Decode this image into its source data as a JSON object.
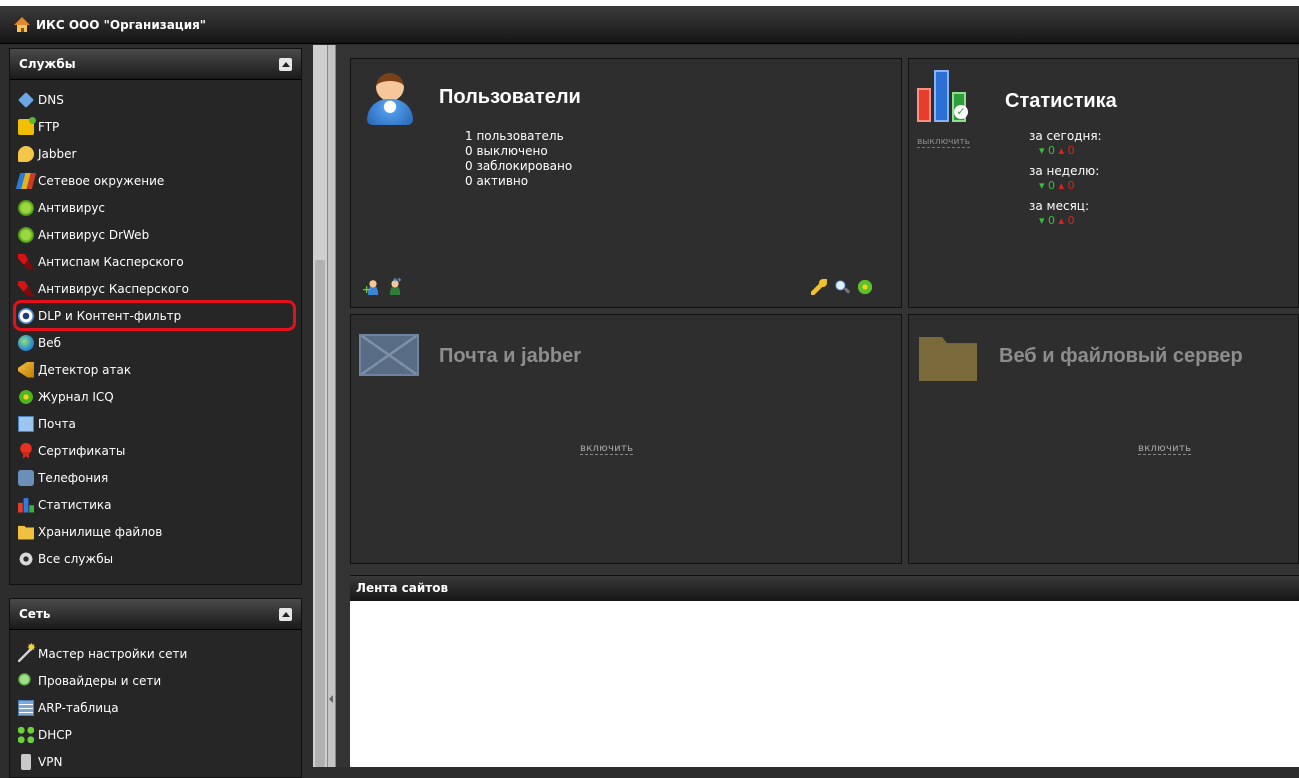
{
  "titlebar": {
    "title": "ИКС ООО \"Организация\""
  },
  "sidebar": {
    "services": {
      "title": "Службы",
      "items": [
        {
          "label": "DNS",
          "icon": "tag-icon"
        },
        {
          "label": "FTP",
          "icon": "ftp-icon"
        },
        {
          "label": "Jabber",
          "icon": "jabber-icon"
        },
        {
          "label": "Сетевое окружение",
          "icon": "network-icon"
        },
        {
          "label": "Антивирус",
          "icon": "bug-icon"
        },
        {
          "label": "Антивирус DrWeb",
          "icon": "bug-icon"
        },
        {
          "label": "Антиспам Касперского",
          "icon": "kaspersky-icon"
        },
        {
          "label": "Антивирус Касперского",
          "icon": "kaspersky-icon"
        },
        {
          "label": "DLP и Контент-фильтр",
          "icon": "eye-icon",
          "highlighted": true
        },
        {
          "label": "Веб",
          "icon": "globe-icon"
        },
        {
          "label": "Детектор атак",
          "icon": "horn-icon"
        },
        {
          "label": "Журнал ICQ",
          "icon": "icq-flower-icon"
        },
        {
          "label": "Почта",
          "icon": "mail-icon"
        },
        {
          "label": "Сертификаты",
          "icon": "certificate-icon"
        },
        {
          "label": "Телефония",
          "icon": "phone-icon"
        },
        {
          "label": "Статистика",
          "icon": "stats-icon"
        },
        {
          "label": "Хранилище файлов",
          "icon": "folder-icon"
        },
        {
          "label": "Все службы",
          "icon": "gear-icon"
        }
      ]
    },
    "network": {
      "title": "Сеть",
      "items": [
        {
          "label": "Мастер настройки сети",
          "icon": "wand-icon"
        },
        {
          "label": "Провайдеры и сети",
          "icon": "search-icon"
        },
        {
          "label": "ARP-таблица",
          "icon": "table-icon"
        },
        {
          "label": "DHCP",
          "icon": "dhcp-icon"
        },
        {
          "label": "VPN",
          "icon": "vpn-icon"
        }
      ]
    }
  },
  "dashboard": {
    "users": {
      "title": "Пользователи",
      "lines": [
        "1 пользователь",
        "0 выключено",
        "0 заблокировано",
        "0 активно"
      ]
    },
    "statistics": {
      "title": "Статистика",
      "disable_label": "выключить",
      "periods": [
        {
          "label": "за сегодня:",
          "down": "0",
          "up": "0"
        },
        {
          "label": "за неделю:",
          "down": "0",
          "up": "0"
        },
        {
          "label": "за месяц:",
          "down": "0",
          "up": "0"
        }
      ]
    },
    "mail": {
      "title": "Почта и jabber",
      "enable_label": "включить"
    },
    "web_files": {
      "title": "Веб и файловый сервер",
      "enable_label": "включить"
    },
    "site_feed": {
      "title": "Лента сайтов"
    }
  }
}
